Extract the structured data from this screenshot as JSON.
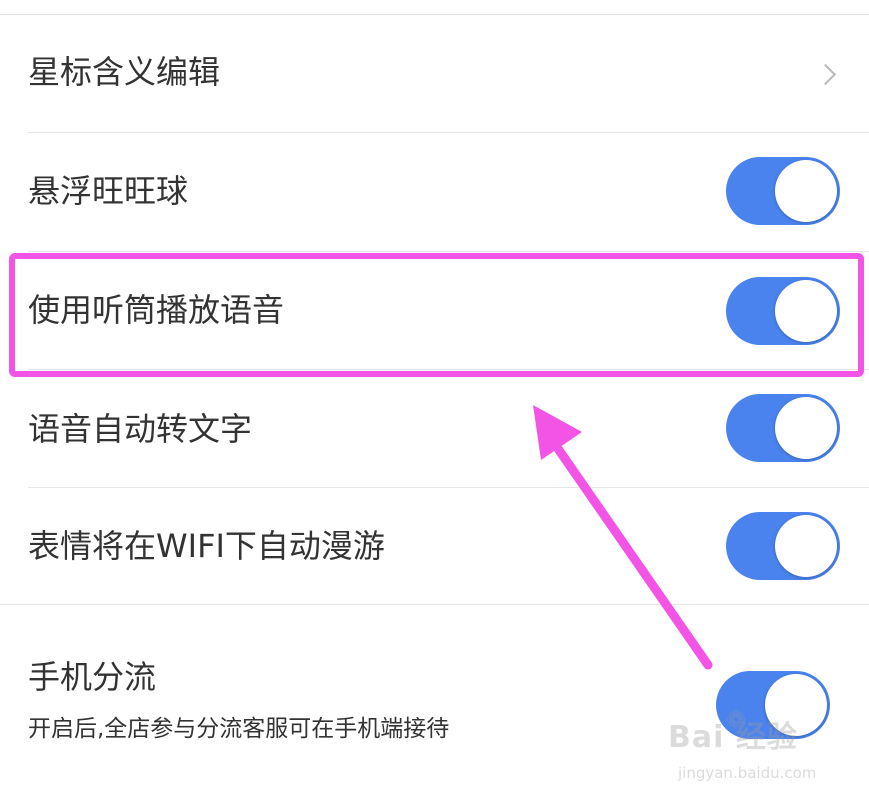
{
  "settings": {
    "items": [
      {
        "label": "星标含义编辑",
        "type": "link"
      },
      {
        "label": "悬浮旺旺球",
        "type": "toggle",
        "on": true
      },
      {
        "label": "使用听筒播放语音",
        "type": "toggle",
        "on": true
      },
      {
        "label": "语音自动转文字",
        "type": "toggle",
        "on": true
      },
      {
        "label": "表情将在WIFI下自动漫游",
        "type": "toggle",
        "on": true
      },
      {
        "label": "手机分流",
        "type": "toggle",
        "on": true,
        "description": "开启后,全店参与分流客服可在手机端接待"
      }
    ]
  },
  "annotation": {
    "highlight_color": "#f255e6"
  },
  "colors": {
    "toggle_on": "#4a83ee",
    "divider": "#e6e6e6",
    "text": "#333333"
  },
  "watermark": {
    "logo_text": "Bai  经验",
    "url_text": "jingyan.baidu.com"
  }
}
